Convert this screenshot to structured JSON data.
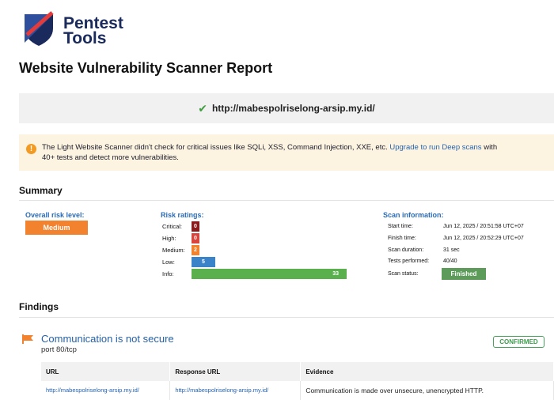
{
  "brand": {
    "line1": "Pentest",
    "line2": "Tools",
    "primary_color": "#1a2a5c",
    "accent_color": "#e63b3b"
  },
  "report_title": "Website Vulnerability Scanner Report",
  "target": {
    "url": "http://mabespolriselong-arsip.my.id/",
    "icon": "check-icon"
  },
  "notice": {
    "icon": "warning-icon",
    "text_line1": "The Light Website Scanner didn't check for critical issues like SQLi, XSS, Command Injection, XXE, etc.",
    "link_text": "Upgrade to run Deep scans",
    "text_tail": "with",
    "text_line2": "40+ tests and detect more vulnerabilities."
  },
  "summary": {
    "title": "Summary",
    "overall_risk": {
      "label": "Overall risk level:",
      "value": "Medium",
      "color": "#f2822e"
    },
    "risk_ratings": {
      "label": "Risk ratings:",
      "items": [
        {
          "name": "Critical:",
          "count": "0",
          "color": "#8b1a1a"
        },
        {
          "name": "High:",
          "count": "0",
          "color": "#d9453d"
        },
        {
          "name": "Medium:",
          "count": "2",
          "color": "#f2822e"
        },
        {
          "name": "Low:",
          "count": "5",
          "color": "#3a83c8"
        },
        {
          "name": "Info:",
          "count": "33",
          "color": "#5ab04c"
        }
      ]
    },
    "scan_info": {
      "label": "Scan information:",
      "rows": [
        {
          "key": "Start time:",
          "value": "Jun 12, 2025 / 20:51:58 UTC+07"
        },
        {
          "key": "Finish time:",
          "value": "Jun 12, 2025 / 20:52:29 UTC+07"
        },
        {
          "key": "Scan duration:",
          "value": "31 sec"
        },
        {
          "key": "Tests performed:",
          "value": "40/40"
        }
      ],
      "status_key": "Scan status:",
      "status_value": "Finished",
      "status_color": "#5d9b5a"
    }
  },
  "findings": {
    "title": "Findings",
    "items": [
      {
        "icon": "flag-icon",
        "title": "Communication is not secure",
        "subtitle": "port 80/tcp",
        "badge": "CONFIRMED",
        "table": {
          "headers": [
            "URL",
            "Response URL",
            "Evidence"
          ],
          "rows": [
            [
              "http://mabespolriselong-arsip.my.id/",
              "http://mabespolriselong-arsip.my.id/",
              "Communication is made over unsecure, unencrypted HTTP."
            ]
          ]
        }
      }
    ]
  }
}
